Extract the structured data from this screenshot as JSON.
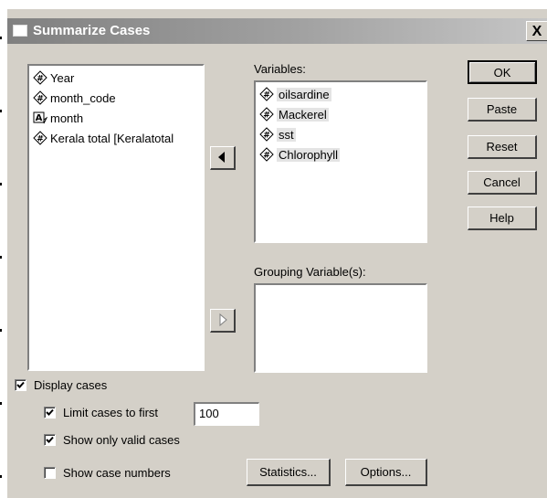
{
  "window": {
    "title": "Summarize Cases",
    "close_glyph": "X"
  },
  "source_list": {
    "items": [
      {
        "label": "Year",
        "icon": "scale-variable-icon"
      },
      {
        "label": "month_code",
        "icon": "scale-variable-icon"
      },
      {
        "label": "month",
        "icon": "string-variable-icon"
      },
      {
        "label": "Kerala total [Keralatotal",
        "icon": "scale-variable-icon"
      }
    ]
  },
  "variables": {
    "label": "Variables:",
    "items": [
      {
        "label": "oilsardine",
        "icon": "scale-variable-icon"
      },
      {
        "label": "Mackerel",
        "icon": "scale-variable-icon"
      },
      {
        "label": "sst",
        "icon": "scale-variable-icon"
      },
      {
        "label": "Chlorophyll",
        "icon": "scale-variable-icon"
      }
    ]
  },
  "grouping": {
    "label": "Grouping Variable(s):"
  },
  "buttons": {
    "ok": "OK",
    "paste": "Paste",
    "reset": "Reset",
    "cancel": "Cancel",
    "help": "Help",
    "statistics": "Statistics...",
    "options": "Options..."
  },
  "checks": {
    "display_cases": {
      "label": "Display cases",
      "checked": true
    },
    "limit_cases": {
      "label": "Limit cases to first",
      "checked": true,
      "value": "100"
    },
    "valid_only": {
      "label": "Show only valid cases",
      "checked": true
    },
    "case_numbers": {
      "label": "Show case numbers",
      "checked": false
    }
  },
  "colors": {
    "dialog": "#d4d0c8",
    "title_start": "#808080",
    "title_end": "#c6c6c6"
  }
}
